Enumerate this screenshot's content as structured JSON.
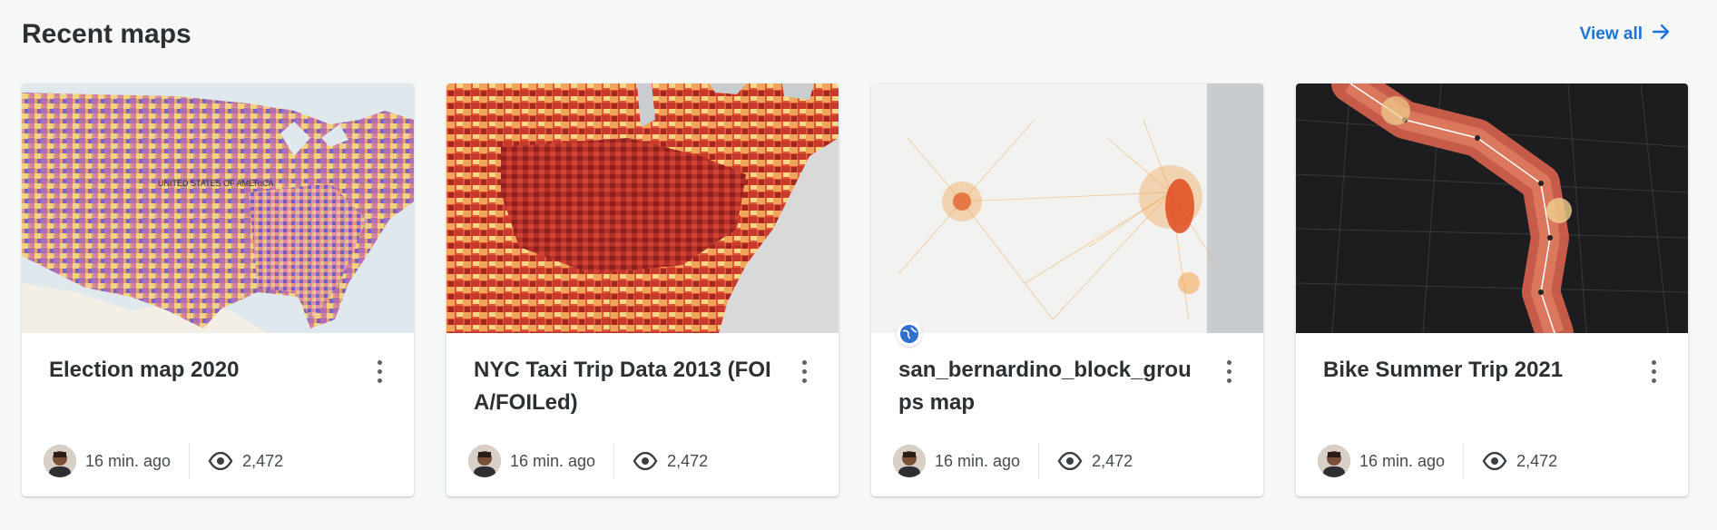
{
  "header": {
    "title": "Recent maps",
    "view_all_label": "View all",
    "accent_color": "#1c74d6"
  },
  "cards": [
    {
      "title": "Election map 2020",
      "time": "16 min. ago",
      "views": "2,472",
      "thumbnail": "election-choropleth-map",
      "map_label": "UNITED STATES OF AMERICA"
    },
    {
      "title": "NYC Taxi Trip Data 2013 (FOIA/FOILed)",
      "time": "16 min. ago",
      "views": "2,472",
      "thumbnail": "county-heat-choropleth-map"
    },
    {
      "title": "san_bernardino_block_groups map",
      "time": "16 min. ago",
      "views": "2,472",
      "thumbnail": "flow-lines-map",
      "public_icon": "globe-icon"
    },
    {
      "title": "Bike Summer Trip 2021",
      "time": "16 min. ago",
      "views": "2,472",
      "thumbnail": "dark-route-map"
    }
  ]
}
